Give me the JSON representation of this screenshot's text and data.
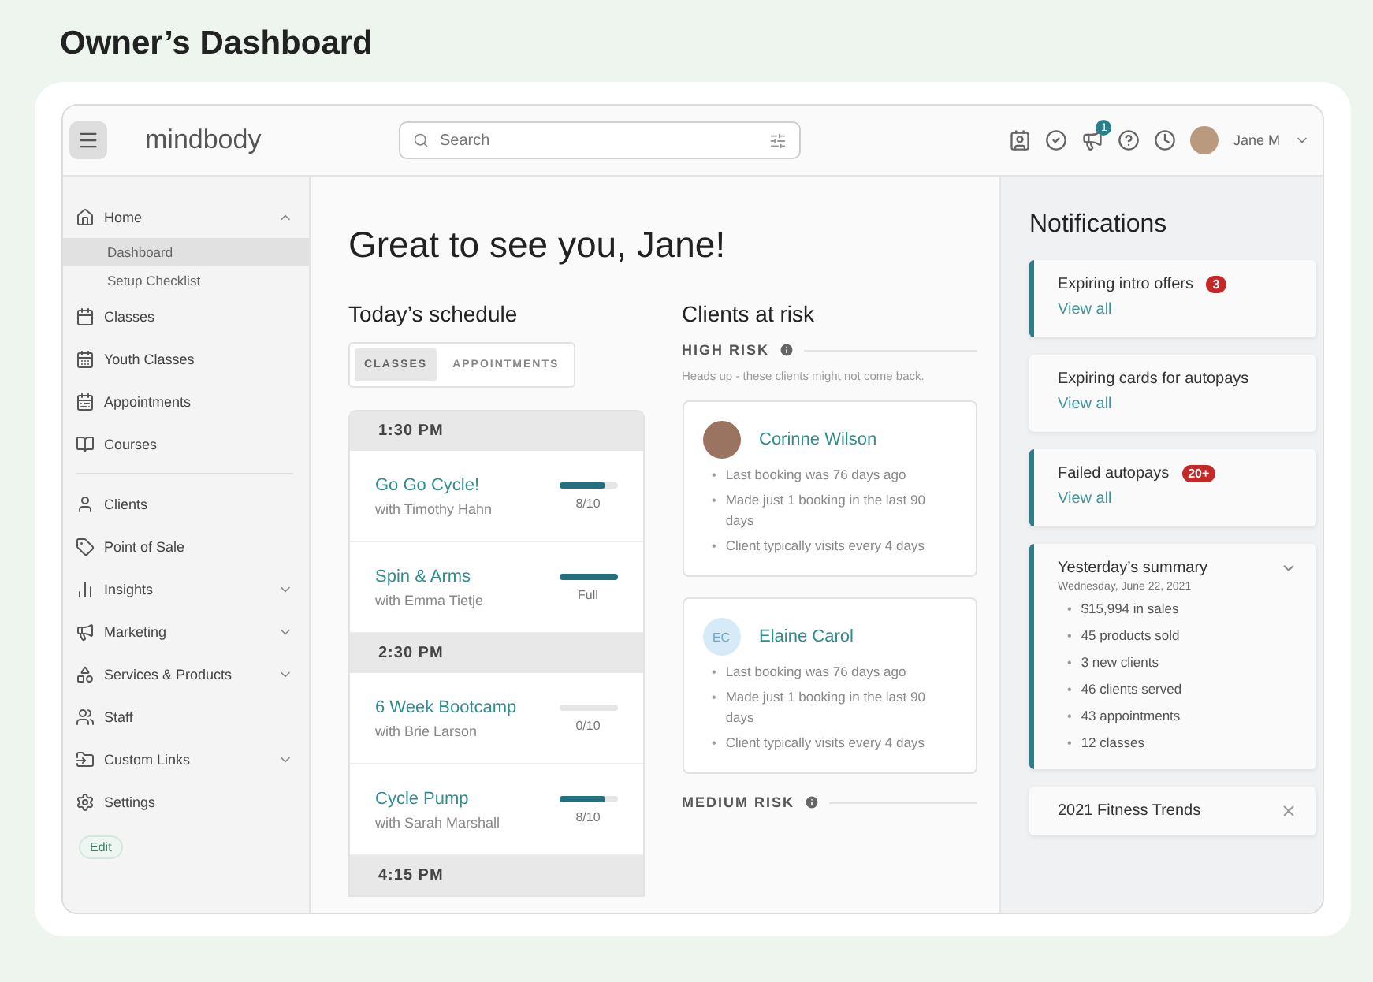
{
  "page_title": "Owner’s Dashboard",
  "topbar": {
    "logo": "mindbody",
    "search": {
      "placeholder": "Search"
    },
    "notification_count": "1",
    "user": "Jane M"
  },
  "sidebar": {
    "groups": [
      [
        {
          "label": "Home",
          "expanded": true,
          "children": [
            {
              "label": "Dashboard",
              "selected": true
            },
            {
              "label": "Setup Checklist",
              "selected": false
            }
          ]
        },
        {
          "label": "Classes"
        },
        {
          "label": "Youth Classes"
        },
        {
          "label": "Appointments"
        },
        {
          "label": "Courses"
        }
      ],
      [
        {
          "label": "Clients"
        },
        {
          "label": "Point of Sale"
        },
        {
          "label": "Insights",
          "expanded": false
        },
        {
          "label": "Marketing",
          "expanded": false
        },
        {
          "label": "Services & Products",
          "expanded": false
        },
        {
          "label": "Staff"
        },
        {
          "label": "Custom Links",
          "expanded": false
        },
        {
          "label": "Settings"
        }
      ]
    ],
    "edit_button": "Edit"
  },
  "greeting": "Great to see you, Jane!",
  "schedule": {
    "title": "Today’s schedule",
    "tabs": [
      {
        "label": "CLASSES",
        "selected": true
      },
      {
        "label": "APPOINTMENTS",
        "selected": false
      }
    ],
    "slots": [
      {
        "time": "1:30 PM",
        "classes": [
          {
            "name": "Go Go Cycle!",
            "instructor": "with Timothy Hahn",
            "level": 0.8,
            "reading": "8/10"
          },
          {
            "name": "Spin & Arms",
            "instructor": "with Emma Tietje",
            "level": 1,
            "reading": "Full"
          }
        ]
      },
      {
        "time": "2:30 PM",
        "classes": [
          {
            "name": "6 Week Bootcamp",
            "instructor": "with Brie Larson",
            "level": 0,
            "reading": "0/10"
          },
          {
            "name": "Cycle Pump",
            "instructor": "with Sarah Marshall",
            "level": 0.8,
            "reading": "8/10"
          }
        ]
      },
      {
        "time": "4:15 PM"
      }
    ]
  },
  "clients_at_risk": {
    "title": "Clients at risk",
    "bullet": "•",
    "sections": [
      {
        "label": "HIGH RISK",
        "note": "Heads up - these clients might not come back.",
        "clients": [
          {
            "kind": "photo",
            "name": "Corinne Wilson",
            "facts": [
              "Last booking was 76 days ago",
              "Made just 1 booking in the last 90 days",
              "Client typically visits every 4 days"
            ]
          },
          {
            "kind": "initials",
            "initials": "EC",
            "name": "Elaine Carol",
            "facts": [
              "Last booking was 76 days ago",
              "Made just 1 booking in the last 90 days",
              "Client typically visits every 4 days"
            ]
          }
        ]
      },
      {
        "label": "MEDIUM RISK"
      }
    ]
  },
  "notifications": {
    "title": "Notifications",
    "cards": [
      {
        "title": "Expiring intro offers",
        "count": "3",
        "link": "View all",
        "flagged": true
      },
      {
        "title": "Expiring cards for autopays",
        "link": "View all",
        "flagged": false
      },
      {
        "title": "Failed autopays",
        "count": "20+",
        "link": "View all",
        "flagged": true
      }
    ],
    "summary": {
      "bullet": "•",
      "title": "Yesterday’s summary",
      "date": "Wednesday, June 22, 2021",
      "expanded": false,
      "flagged": true,
      "items": [
        "$15,994 in sales",
        "45 products sold",
        "3 new clients",
        "46 clients served",
        "43 appointments",
        "12 classes"
      ]
    },
    "last_card": {
      "title": "2021 Fitness Trends"
    }
  }
}
